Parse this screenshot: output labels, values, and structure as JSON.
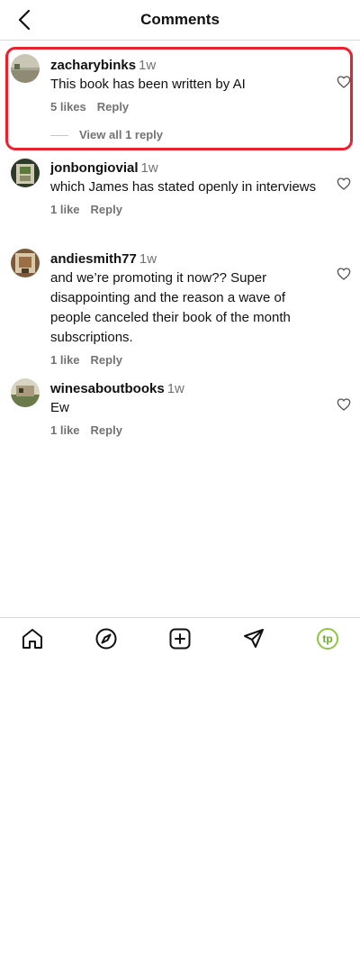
{
  "header": {
    "title": "Comments"
  },
  "comments": [
    {
      "username": "zacharybinks",
      "time": "1w",
      "text": "This book has been written by AI",
      "likes": "5 likes",
      "reply": "Reply",
      "view_replies": "View all 1 reply"
    },
    {
      "username": "jonbongiovial",
      "time": "1w",
      "text": "which James has stated openly in interviews",
      "likes": "1 like",
      "reply": "Reply"
    },
    {
      "username": "andiesmith77",
      "time": "1w",
      "text": "and we’re promoting it now?? Super disappointing and the reason a wave of people canceled their book of the month subscriptions.",
      "likes": "1 like",
      "reply": "Reply"
    },
    {
      "username": "winesaboutbooks",
      "time": "1w",
      "text": "Ew",
      "likes": "1 like",
      "reply": "Reply"
    }
  ],
  "colors": {
    "highlight": "#e8222f",
    "secondary_text": "#737373",
    "profile_accent": "#8dc63f"
  },
  "icons": {
    "back": "chevron-left-icon",
    "home": "home-icon",
    "explore": "compass-icon",
    "create": "plus-square-icon",
    "messages": "paper-plane-icon",
    "profile": "profile-avatar-icon",
    "like": "heart-icon"
  },
  "bottom_nav": {
    "profile_initials": "tp"
  }
}
